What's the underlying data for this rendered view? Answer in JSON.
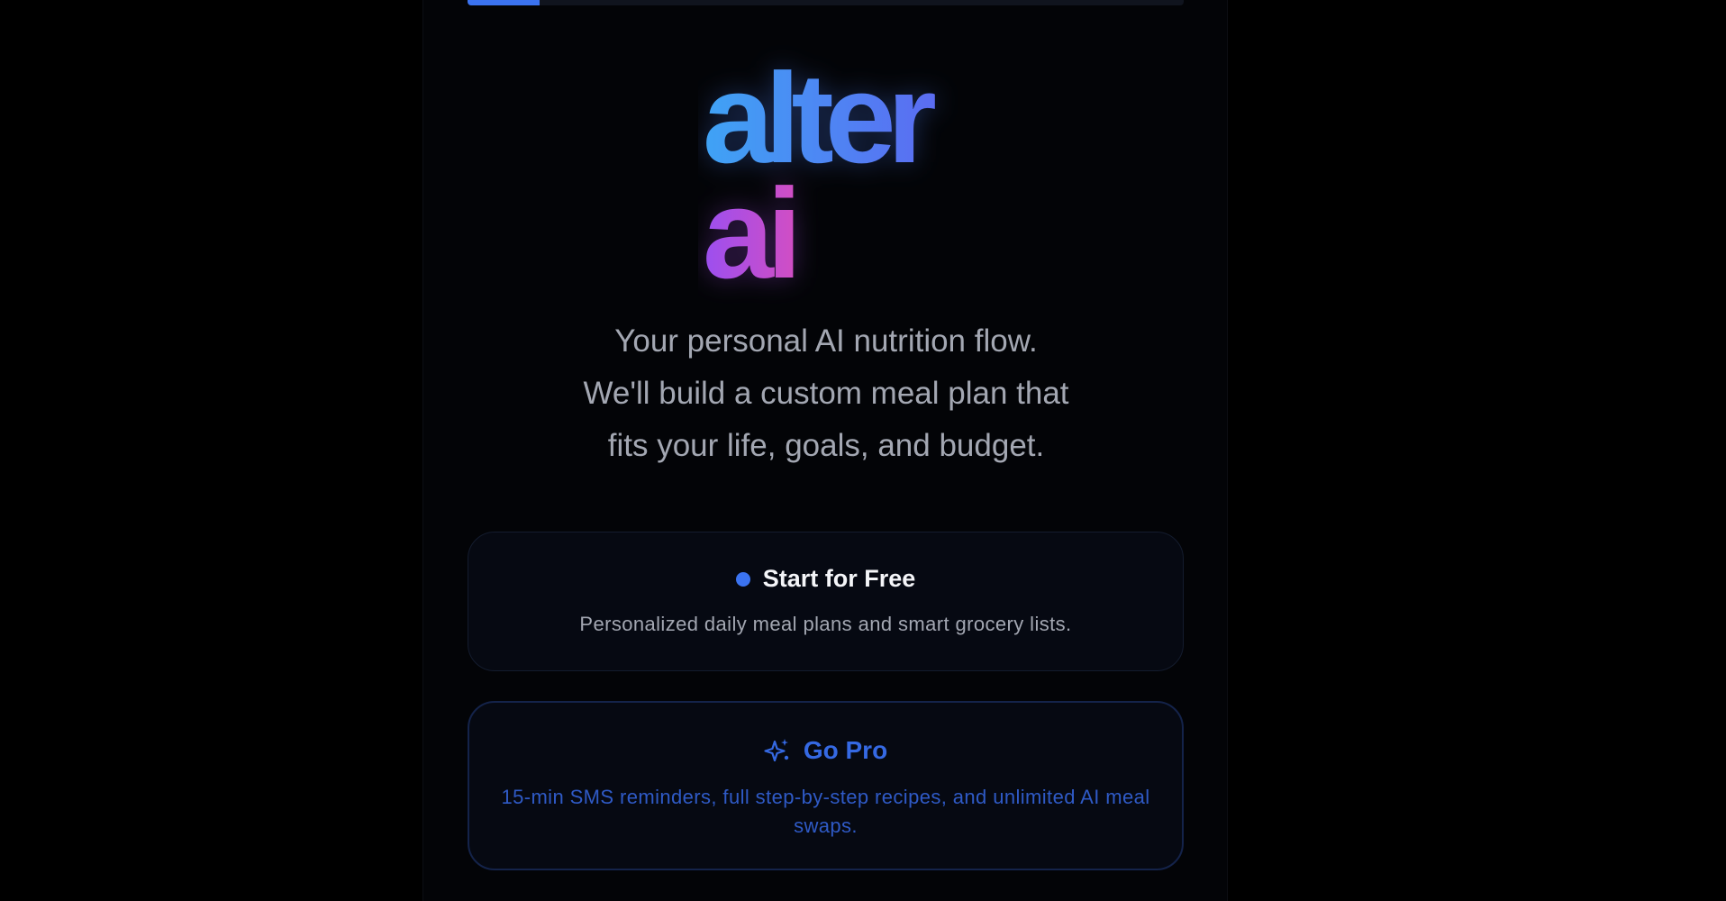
{
  "progress": {
    "fraction": 0.1
  },
  "logo": {
    "line1": "alter",
    "line2": "ai",
    "colors": {
      "blue": "#3fa3f5",
      "indigo": "#5b6cf2",
      "violet": "#9b4ff0",
      "pink": "#d14ec4"
    }
  },
  "tagline": {
    "line1": "Your personal AI nutrition flow.",
    "line2": "We'll build a custom meal plan that",
    "line3": "fits your life, goals, and budget."
  },
  "free_plan": {
    "icon": "dot-icon",
    "title": "Start for Free",
    "description": "Personalized daily meal plans and smart grocery lists."
  },
  "pro_plan": {
    "icon": "sparkles-icon",
    "title": "Go Pro",
    "description": "15-min SMS reminders, full step-by-step recipes, and unlimited AI meal swaps."
  },
  "colors": {
    "accent": "#3b73f0",
    "pro_text": "#3569e3",
    "muted_text": "#a3a7b2"
  }
}
